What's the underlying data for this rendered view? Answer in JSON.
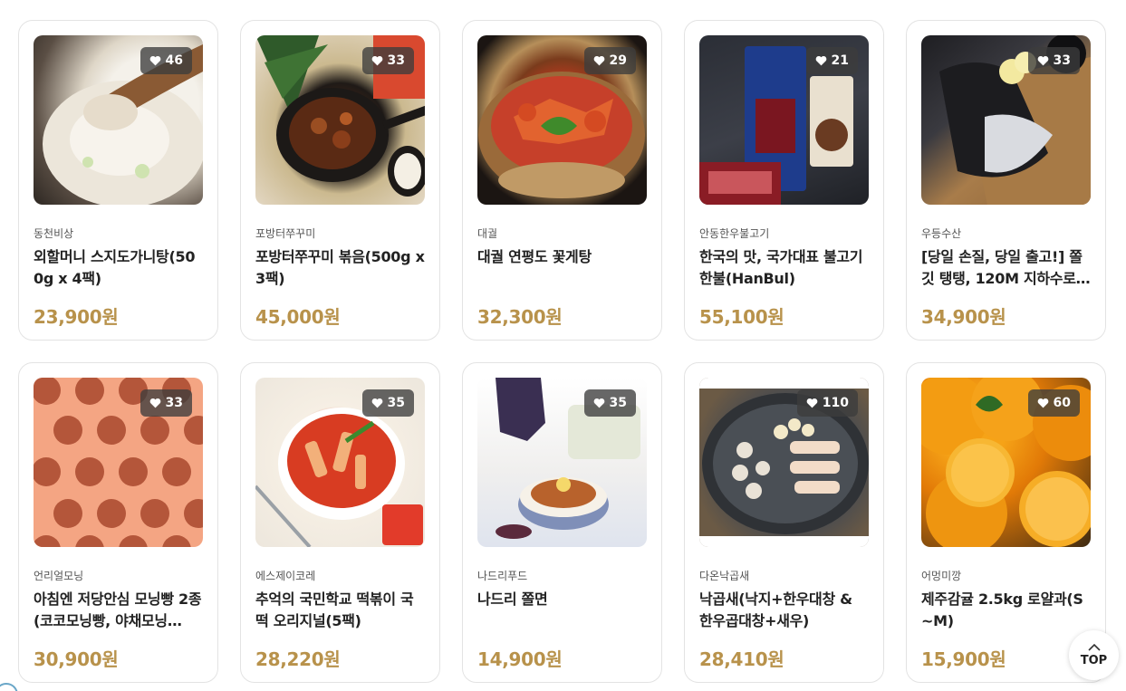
{
  "products": [
    {
      "brand": "동천비상",
      "name": "외할머니 스지도가니탕(500g x 4팩)",
      "price": "23,900원",
      "likes": "46",
      "image": "beef-tendon-soup"
    },
    {
      "brand": "포방터쭈꾸미",
      "name": "포방터쭈꾸미 볶음(500g x 3팩)",
      "price": "45,000원",
      "likes": "33",
      "image": "stir-fried-webfoot-octopus"
    },
    {
      "brand": "대궐",
      "name": "대궐 연평도 꽃게탕",
      "price": "32,300원",
      "likes": "29",
      "image": "spicy-crab-stew"
    },
    {
      "brand": "안동한우불고기",
      "name": "한국의 맛, 국가대표 불고기 한불(HanBul)",
      "price": "55,100원",
      "likes": "21",
      "image": "bulgogi-package"
    },
    {
      "brand": "우등수산",
      "name": "[당일 손질, 당일 출고!] 쫄깃 탱탱, 120M 지하수로 …",
      "price": "34,900원",
      "likes": "33",
      "image": "fish-fillet-on-board"
    },
    {
      "brand": "언리얼모닝",
      "name": "아침엔 저당안심 모닝빵 2종(코코모닝빵, 야채모닝…",
      "price": "30,900원",
      "likes": "33",
      "image": "bread-rolls-grid"
    },
    {
      "brand": "에스제이코레",
      "name": "추억의 국민학교 떡볶이 국떡 오리지널(5팩)",
      "price": "28,220원",
      "likes": "35",
      "image": "tteokbokki"
    },
    {
      "brand": "나드리푸드",
      "name": "나드리 쫄면",
      "price": "14,900원",
      "likes": "35",
      "image": "jjolmyeon-noodles"
    },
    {
      "brand": "다온낙곱새",
      "name": "낙곱새(낙지+한우대창 & 한우곱대창+새우)",
      "price": "28,410원",
      "likes": "110",
      "image": "nakgopsae-hotpot"
    },
    {
      "brand": "어멍미깡",
      "name": "제주감귤 2.5kg 로얄과(S~M)",
      "price": "15,900원",
      "likes": "60",
      "image": "jeju-oranges"
    }
  ],
  "top_button": {
    "label": "TOP"
  }
}
